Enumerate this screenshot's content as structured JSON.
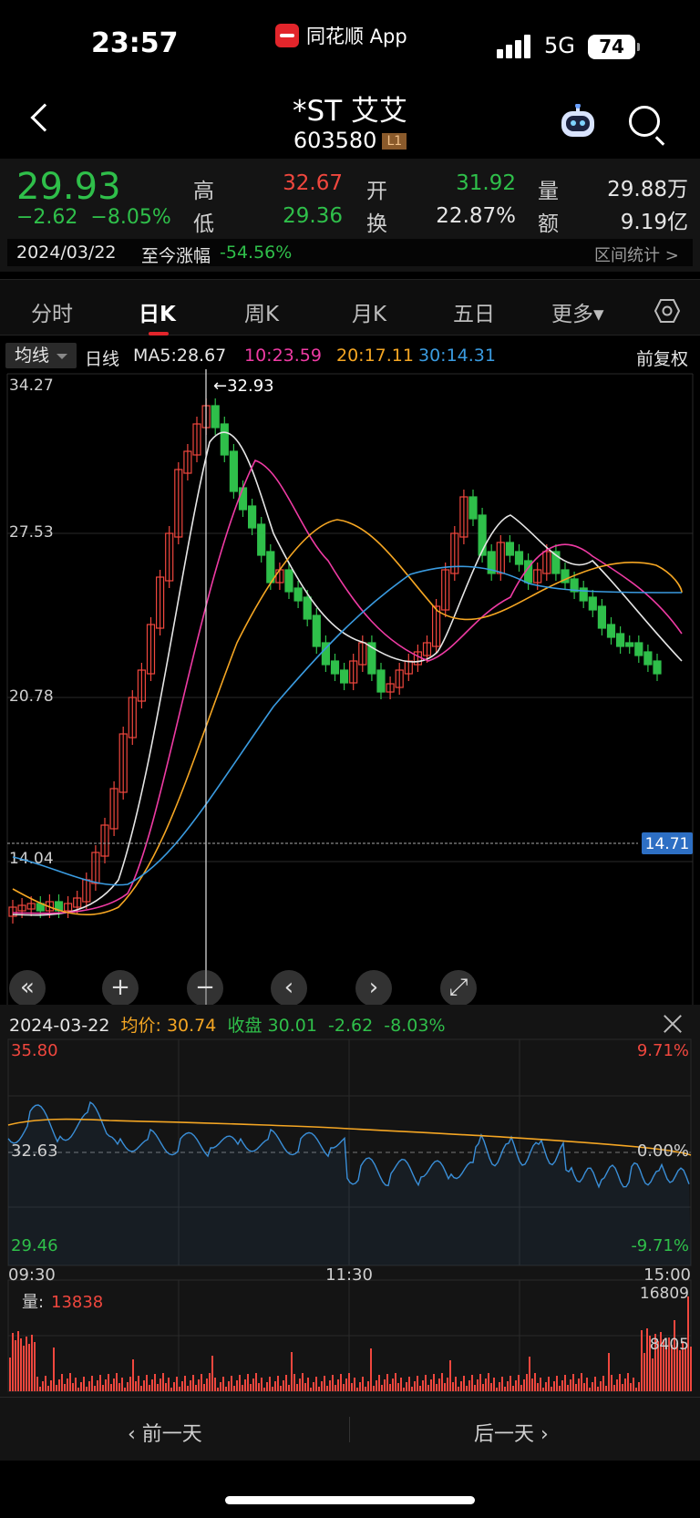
{
  "status": {
    "time": "23:57",
    "app_name": "同花顺 App",
    "network": "5G",
    "battery": "74"
  },
  "header": {
    "name": "*ST 艾艾",
    "code": "603580",
    "level": "L1"
  },
  "quote": {
    "price": "29.93",
    "change": "−2.62",
    "change_pct": "−8.05%",
    "high_label": "高",
    "high": "32.67",
    "low_label": "低",
    "low": "29.36",
    "open_label": "开",
    "open": "31.92",
    "turnover_label": "换",
    "turnover": "22.87%",
    "volume_label": "量",
    "volume": "29.88万",
    "amount_label": "额",
    "amount": "9.19亿",
    "date": "2024/03/22",
    "range_label": "至今涨幅",
    "range_value": "-54.56%",
    "stat_link": "区间统计 >"
  },
  "tabs": [
    "分时",
    "日K",
    "周K",
    "月K",
    "五日",
    "更多▾"
  ],
  "ma_legend": {
    "select": "均线",
    "period": "日线",
    "ma5": "MA5:28.67",
    "ma10": "10:23.59",
    "ma20": "20:17.11",
    "ma30": "30:14.31",
    "adjust": "前复权"
  },
  "colors": {
    "up": "#f0473e",
    "down": "#2fbf4a",
    "ma5": "#e6e6e6",
    "ma10": "#ef3ba4",
    "ma20": "#f5a623",
    "ma30": "#3a9be0"
  },
  "kline": {
    "y_labels": [
      "34.27",
      "27.53",
      "20.78",
      "14.04"
    ],
    "cursor_label": "←32.93",
    "current_price_tag": "14.71",
    "controls": [
      "«",
      "+",
      "−",
      "‹",
      "›",
      "⤢"
    ]
  },
  "intraday": {
    "date": "2024-03-22",
    "avg_label": "均价:",
    "avg_value": "30.74",
    "close_label": "收盘",
    "close_value": "30.01",
    "change": "-2.62",
    "change_pct": "-8.03%",
    "y_top": "35.80",
    "y_mid": "32.63",
    "y_bot": "29.46",
    "pct_top": "9.71%",
    "pct_mid": "0.00%",
    "pct_bot": "-9.71%",
    "times": [
      "09:30",
      "11:30",
      "15:00"
    ],
    "vol_label": "量:",
    "vol_value": "13838",
    "vol_top": "16809",
    "vol_mid": "8405"
  },
  "footer": {
    "prev": "‹  前一天",
    "next": "后一天  ›"
  },
  "chart_data": [
    {
      "type": "candlestick",
      "y_range": [
        14.04,
        34.27
      ],
      "series": [
        {
          "name": "MA5",
          "last": 28.67
        },
        {
          "name": "MA10",
          "last": 23.59
        },
        {
          "name": "MA20",
          "last": 17.11
        },
        {
          "name": "MA30",
          "last": 14.31
        }
      ]
    },
    {
      "type": "line",
      "x": [
        "09:30",
        "11:30",
        "15:00"
      ],
      "y_range": [
        29.46,
        35.8
      ],
      "series": [
        {
          "name": "均价"
        },
        {
          "name": "收盘"
        }
      ]
    }
  ]
}
